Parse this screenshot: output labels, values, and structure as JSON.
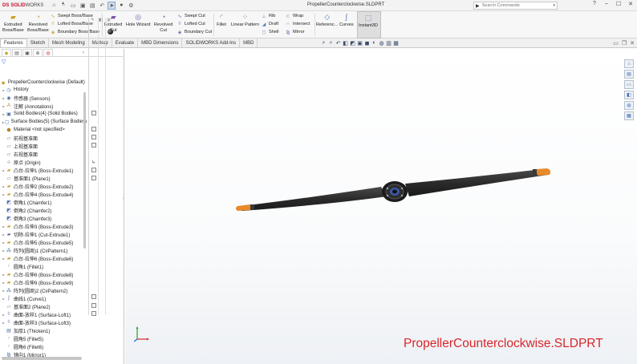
{
  "titlebar": {
    "logo_ds": "DS",
    "logo_solid": "SOLID",
    "logo_works": "WORKS",
    "document_title": "PropellerCounterclockwise.SLDPRT",
    "search_placeholder": "Search Commands",
    "quick_access_icons": [
      "home-icon",
      "new-file-icon",
      "open-folder-icon",
      "save-icon",
      "print-icon",
      "undo-icon",
      "select-arrow-icon",
      "traffic-light-icon",
      "settings-icon"
    ],
    "window_buttons": [
      "?",
      "–",
      "☐",
      "✕"
    ]
  },
  "ribbon": {
    "extruded_boss": "Extruded\nBoss/Base",
    "revolved_boss": "Revolved\nBoss/Base",
    "swept_boss": "Swept Boss/Base",
    "lofted_boss": "Lofted Boss/Base",
    "boundary_boss": "Boundary Boss/Base",
    "extruded_cut": "Extruded\nCut",
    "hole_wizard": "Hole Wizard",
    "revolved_cut": "Revolved\nCut",
    "swept_cut": "Swept Cut",
    "lofted_cut": "Lofted Cut",
    "boundary_cut": "Boundary Cut",
    "fillet": "Fillet",
    "linear_pattern": "Linear Pattern",
    "rib": "Rib",
    "draft": "Draft",
    "shell": "Shell",
    "wrap": "Wrap",
    "intersect": "Intersect",
    "mirror": "Mirror",
    "reference": "Referenc...",
    "curves": "Curves",
    "instant3d": "Instant3D"
  },
  "command_tabs": [
    "Features",
    "Sketch",
    "Mesh Modeling",
    "Markup",
    "Evaluate",
    "MBD Dimensions",
    "SOLIDWORKS Add-Ins",
    "MBD"
  ],
  "tree": {
    "root": "PropellerCounterclockwise (Default)",
    "nodes": [
      {
        "label": "History",
        "expand": true
      },
      {
        "label": "传感器 (Sensors)",
        "expand": true
      },
      {
        "label": "注解 (Annotations)",
        "expand": true
      },
      {
        "label": "Solid Bodies(4) (Solid Bodies)",
        "expand": true
      },
      {
        "label": "Surface Bodies(5) (Surface Bodies)",
        "expand": true
      },
      {
        "label": "Material <not specified>",
        "expand": false
      },
      {
        "label": "前视基准面",
        "expand": false
      },
      {
        "label": "上视基准面",
        "expand": false
      },
      {
        "label": "右视基准面",
        "expand": false
      },
      {
        "label": "原点 (Origin)",
        "expand": false
      },
      {
        "label": "凸台-拉伸1 (Boss-Extrude1)",
        "expand": true
      },
      {
        "label": "基准面1 (Plane1)",
        "expand": false
      },
      {
        "label": "凸台-拉伸2 (Boss-Extrude2)",
        "expand": true
      },
      {
        "label": "凸台-拉伸4 (Boss-Extrude4)",
        "expand": true
      },
      {
        "label": "倒角1 (Chamfer1)",
        "expand": false
      },
      {
        "label": "倒角2 (Chamfer2)",
        "expand": false
      },
      {
        "label": "倒角3 (Chamfer3)",
        "expand": false
      },
      {
        "label": "凸台-拉伸3 (Boss-Extrude3)",
        "expand": true
      },
      {
        "label": "切除-拉伸1 (Cut-Extrude1)",
        "expand": true
      },
      {
        "label": "凸台-拉伸5 (Boss-Extrude5)",
        "expand": true
      },
      {
        "label": "阵列(圆周)1 (CirPattern1)",
        "expand": true
      },
      {
        "label": "凸台-拉伸6 (Boss-Extrude6)",
        "expand": true
      },
      {
        "label": "圆角1 (Fillet1)",
        "expand": false
      },
      {
        "label": "凸台-拉伸8 (Boss-Extrude8)",
        "expand": true
      },
      {
        "label": "凸台-拉伸9 (Boss-Extrude9)",
        "expand": true
      },
      {
        "label": "阵列(圆周)2 (CirPattern2)",
        "expand": true
      },
      {
        "label": "曲线1 (Curve1)",
        "expand": true
      },
      {
        "label": "基准面2 (Plane2)",
        "expand": false
      },
      {
        "label": "曲面-放样1 (Surface-Loft1)",
        "expand": true
      },
      {
        "label": "曲面-放样3 (Surface-Loft3)",
        "expand": true
      },
      {
        "label": "加厚1 (Thicken1)",
        "expand": false
      },
      {
        "label": "圆角5 (Fillet5)",
        "expand": false
      },
      {
        "label": "圆角6 (Fillet6)",
        "expand": false
      },
      {
        "label": "镜向1 (Mirror1)",
        "expand": false
      }
    ]
  },
  "viewport": {
    "watermark": "PropellerCounterclockwise.SLDPRT",
    "watermark_color": "#d9262a",
    "blade_color": "#2b2b2b",
    "tip_color": "#e88a2a"
  }
}
